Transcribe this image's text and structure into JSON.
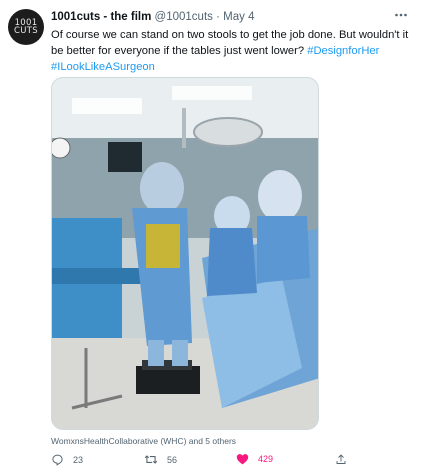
{
  "tweet": {
    "avatar_text": "1001 CUTS",
    "display_name": "1001cuts - the film",
    "handle": "@1001cuts",
    "separator": "·",
    "date": "May 4",
    "text": "Of course we can stand on two stools to get the job done. But wouldn't it be better for everyone if the tables just went lower?",
    "hashtags": [
      "#DesignforHer",
      "#ILookLikeASurgeon"
    ],
    "tagged_people": "WomxnsHealthCollaborative (WHC) and 5 others",
    "reply_count": "23",
    "retweet_count": "56",
    "like_count": "429",
    "like_color": "#f91880",
    "link_color": "#1d9bf0"
  },
  "icons": [
    "more-icon",
    "reply-icon",
    "retweet-icon",
    "like-icon",
    "share-icon"
  ]
}
